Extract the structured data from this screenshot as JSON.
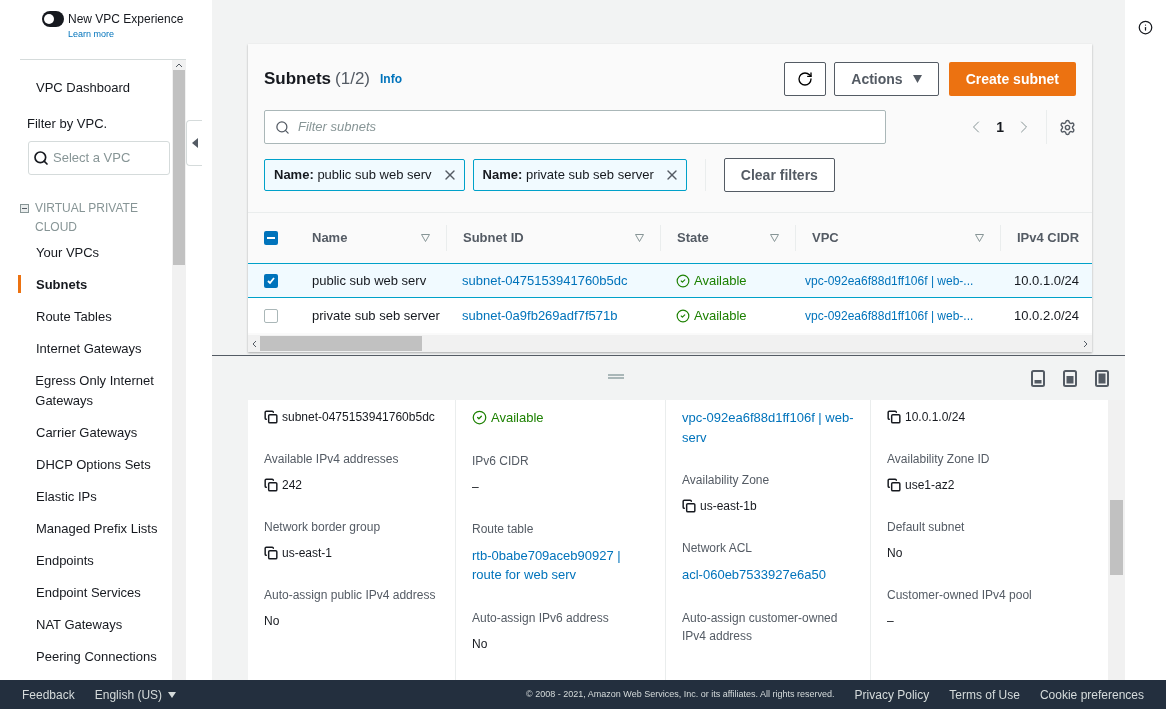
{
  "banner": {
    "title": "New VPC Experience",
    "link": "Learn more"
  },
  "sidebar": {
    "dashboard": "VPC Dashboard",
    "filter_label": "Filter by VPC.",
    "filter_placeholder": "Select a VPC",
    "section": {
      "title": "VIRTUAL PRIVATE CLOUD",
      "expanded": true
    },
    "items": [
      {
        "label": "Your VPCs",
        "selected": false
      },
      {
        "label": "Subnets",
        "selected": true
      },
      {
        "label": "Route Tables",
        "selected": false
      },
      {
        "label": "Internet Gateways",
        "selected": false
      },
      {
        "label": "Egress Only Internet Gateways",
        "selected": false
      },
      {
        "label": "Carrier Gateways",
        "selected": false
      },
      {
        "label": "DHCP Options Sets",
        "selected": false
      },
      {
        "label": "Elastic IPs",
        "selected": false
      },
      {
        "label": "Managed Prefix Lists",
        "selected": false
      },
      {
        "label": "Endpoints",
        "selected": false
      },
      {
        "label": "Endpoint Services",
        "selected": false
      },
      {
        "label": "NAT Gateways",
        "selected": false
      },
      {
        "label": "Peering Connections",
        "selected": false
      }
    ]
  },
  "table": {
    "title": "Subnets",
    "count": "(1/2)",
    "info": "Info",
    "actions": "Actions",
    "create": "Create subnet",
    "search_placeholder": "Filter subnets",
    "page": "1",
    "filters": [
      {
        "key": "Name:",
        "value": "public sub web serv"
      },
      {
        "key": "Name:",
        "value": "private sub seb server"
      }
    ],
    "clear": "Clear filters",
    "select_all": {
      "indeterminate": true
    },
    "columns": [
      {
        "label": "Name",
        "sortable": true
      },
      {
        "label": "Subnet ID",
        "sortable": true
      },
      {
        "label": "State",
        "sortable": true
      },
      {
        "label": "VPC",
        "sortable": true
      },
      {
        "label": "IPv4 CIDR"
      }
    ],
    "rows": [
      {
        "selected": true,
        "name": "public sub web serv",
        "subnet_id": "subnet-0475153941760b5dc",
        "state": "Available",
        "vpc": "vpc-092ea6f88d1ff106f | web-...",
        "cidr": "10.0.1.0/24"
      },
      {
        "selected": false,
        "name": "private sub seb server",
        "subnet_id": "subnet-0a9fb269adf7f571b",
        "state": "Available",
        "vpc": "vpc-092ea6f88d1ff106f | web-...",
        "cidr": "10.0.2.0/24"
      }
    ]
  },
  "details": [
    [
      {
        "kind": "copy",
        "value": "subnet-0475153941760b5dc"
      },
      {
        "kind": "copy",
        "label": "Available IPv4 addresses",
        "value": "242"
      },
      {
        "kind": "copy",
        "label": "Network border group",
        "value": "us-east-1"
      },
      {
        "kind": "text",
        "label": "Auto-assign public IPv4 address",
        "value": "No"
      }
    ],
    [
      {
        "kind": "status",
        "value": "Available"
      },
      {
        "kind": "text",
        "label": "IPv6 CIDR",
        "value": "–"
      },
      {
        "kind": "link",
        "label": "Route table",
        "value": "rtb-0babe709aceb90927 | route for web serv"
      },
      {
        "kind": "text",
        "label": "Auto-assign IPv6 address",
        "value": "No"
      }
    ],
    [
      {
        "kind": "link",
        "value": "vpc-092ea6f88d1ff106f | web-serv"
      },
      {
        "kind": "copy",
        "label": "Availability Zone",
        "value": "us-east-1b"
      },
      {
        "kind": "link",
        "label": "Network ACL",
        "value": "acl-060eb7533927e6a50"
      },
      {
        "label": "Auto-assign customer-owned IPv4 address"
      }
    ],
    [
      {
        "kind": "copy",
        "value": "10.0.1.0/24"
      },
      {
        "kind": "copy",
        "label": "Availability Zone ID",
        "value": "use1-az2"
      },
      {
        "kind": "text",
        "label": "Default subnet",
        "value": "No"
      },
      {
        "kind": "text",
        "label": "Customer-owned IPv4 pool",
        "value": "–"
      }
    ]
  ],
  "footer": {
    "feedback": "Feedback",
    "language": "English (US)",
    "copyright": "© 2008 - 2021, Amazon Web Services, Inc. or its affiliates. All rights reserved.",
    "links": [
      "Privacy Policy",
      "Terms of Use",
      "Cookie preferences"
    ]
  }
}
